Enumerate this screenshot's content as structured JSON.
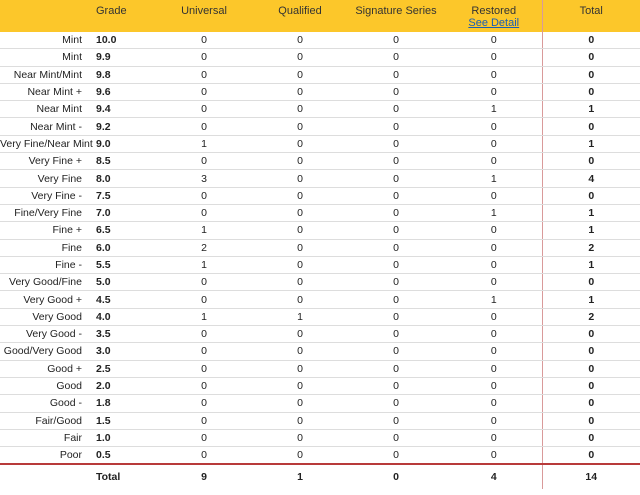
{
  "headers": {
    "grade": "Grade",
    "universal": "Universal",
    "qualified": "Qualified",
    "signature": "Signature Series",
    "restored": "Restored",
    "see_detail": "See Detail",
    "total": "Total"
  },
  "rows": [
    {
      "label": "Mint",
      "grade": "10.0",
      "universal": "0",
      "qualified": "0",
      "signature": "0",
      "restored": "0",
      "total": "0"
    },
    {
      "label": "Mint",
      "grade": "9.9",
      "universal": "0",
      "qualified": "0",
      "signature": "0",
      "restored": "0",
      "total": "0"
    },
    {
      "label": "Near Mint/Mint",
      "grade": "9.8",
      "universal": "0",
      "qualified": "0",
      "signature": "0",
      "restored": "0",
      "total": "0"
    },
    {
      "label": "Near Mint +",
      "grade": "9.6",
      "universal": "0",
      "qualified": "0",
      "signature": "0",
      "restored": "0",
      "total": "0"
    },
    {
      "label": "Near Mint",
      "grade": "9.4",
      "universal": "0",
      "qualified": "0",
      "signature": "0",
      "restored": "1",
      "total": "1"
    },
    {
      "label": "Near Mint -",
      "grade": "9.2",
      "universal": "0",
      "qualified": "0",
      "signature": "0",
      "restored": "0",
      "total": "0"
    },
    {
      "label": "Very Fine/Near Mint",
      "grade": "9.0",
      "universal": "1",
      "qualified": "0",
      "signature": "0",
      "restored": "0",
      "total": "1"
    },
    {
      "label": "Very Fine +",
      "grade": "8.5",
      "universal": "0",
      "qualified": "0",
      "signature": "0",
      "restored": "0",
      "total": "0"
    },
    {
      "label": "Very Fine",
      "grade": "8.0",
      "universal": "3",
      "qualified": "0",
      "signature": "0",
      "restored": "1",
      "total": "4"
    },
    {
      "label": "Very Fine -",
      "grade": "7.5",
      "universal": "0",
      "qualified": "0",
      "signature": "0",
      "restored": "0",
      "total": "0"
    },
    {
      "label": "Fine/Very Fine",
      "grade": "7.0",
      "universal": "0",
      "qualified": "0",
      "signature": "0",
      "restored": "1",
      "total": "1"
    },
    {
      "label": "Fine +",
      "grade": "6.5",
      "universal": "1",
      "qualified": "0",
      "signature": "0",
      "restored": "0",
      "total": "1"
    },
    {
      "label": "Fine",
      "grade": "6.0",
      "universal": "2",
      "qualified": "0",
      "signature": "0",
      "restored": "0",
      "total": "2"
    },
    {
      "label": "Fine -",
      "grade": "5.5",
      "universal": "1",
      "qualified": "0",
      "signature": "0",
      "restored": "0",
      "total": "1"
    },
    {
      "label": "Very Good/Fine",
      "grade": "5.0",
      "universal": "0",
      "qualified": "0",
      "signature": "0",
      "restored": "0",
      "total": "0"
    },
    {
      "label": "Very Good +",
      "grade": "4.5",
      "universal": "0",
      "qualified": "0",
      "signature": "0",
      "restored": "1",
      "total": "1"
    },
    {
      "label": "Very Good",
      "grade": "4.0",
      "universal": "1",
      "qualified": "1",
      "signature": "0",
      "restored": "0",
      "total": "2"
    },
    {
      "label": "Very Good -",
      "grade": "3.5",
      "universal": "0",
      "qualified": "0",
      "signature": "0",
      "restored": "0",
      "total": "0"
    },
    {
      "label": "Good/Very Good",
      "grade": "3.0",
      "universal": "0",
      "qualified": "0",
      "signature": "0",
      "restored": "0",
      "total": "0"
    },
    {
      "label": "Good +",
      "grade": "2.5",
      "universal": "0",
      "qualified": "0",
      "signature": "0",
      "restored": "0",
      "total": "0"
    },
    {
      "label": "Good",
      "grade": "2.0",
      "universal": "0",
      "qualified": "0",
      "signature": "0",
      "restored": "0",
      "total": "0"
    },
    {
      "label": "Good -",
      "grade": "1.8",
      "universal": "0",
      "qualified": "0",
      "signature": "0",
      "restored": "0",
      "total": "0"
    },
    {
      "label": "Fair/Good",
      "grade": "1.5",
      "universal": "0",
      "qualified": "0",
      "signature": "0",
      "restored": "0",
      "total": "0"
    },
    {
      "label": "Fair",
      "grade": "1.0",
      "universal": "0",
      "qualified": "0",
      "signature": "0",
      "restored": "0",
      "total": "0"
    },
    {
      "label": "Poor",
      "grade": "0.5",
      "universal": "0",
      "qualified": "0",
      "signature": "0",
      "restored": "0",
      "total": "0"
    }
  ],
  "totals": {
    "label": "Total",
    "universal": "9",
    "qualified": "1",
    "signature": "0",
    "restored": "4",
    "total": "14"
  },
  "colors": {
    "header_bg": "#fcc72a",
    "total_rule": "#b83a3a",
    "link": "#1a5fb4"
  }
}
